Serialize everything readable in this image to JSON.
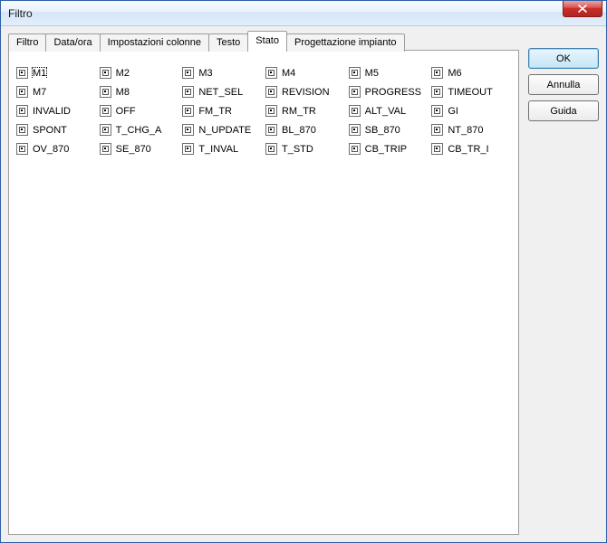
{
  "window": {
    "title": "Filtro"
  },
  "tabs": [
    {
      "label": "Filtro"
    },
    {
      "label": "Data/ora"
    },
    {
      "label": "Impostazioni colonne"
    },
    {
      "label": "Testo"
    },
    {
      "label": "Stato"
    },
    {
      "label": "Progettazione impianto"
    }
  ],
  "active_tab_index": 4,
  "stato_checks": [
    "M1",
    "M2",
    "M3",
    "M4",
    "M5",
    "M6",
    "M7",
    "M8",
    "NET_SEL",
    "REVISION",
    "PROGRESS",
    "TIMEOUT",
    "INVALID",
    "OFF",
    "FM_TR",
    "RM_TR",
    "ALT_VAL",
    "GI",
    "SPONT",
    "T_CHG_A",
    "N_UPDATE",
    "BL_870",
    "SB_870",
    "NT_870",
    "OV_870",
    "SE_870",
    "T_INVAL",
    "T_STD",
    "CB_TRIP",
    "CB_TR_I"
  ],
  "focused_check_index": 0,
  "buttons": {
    "ok": "OK",
    "cancel": "Annulla",
    "help": "Guida"
  }
}
